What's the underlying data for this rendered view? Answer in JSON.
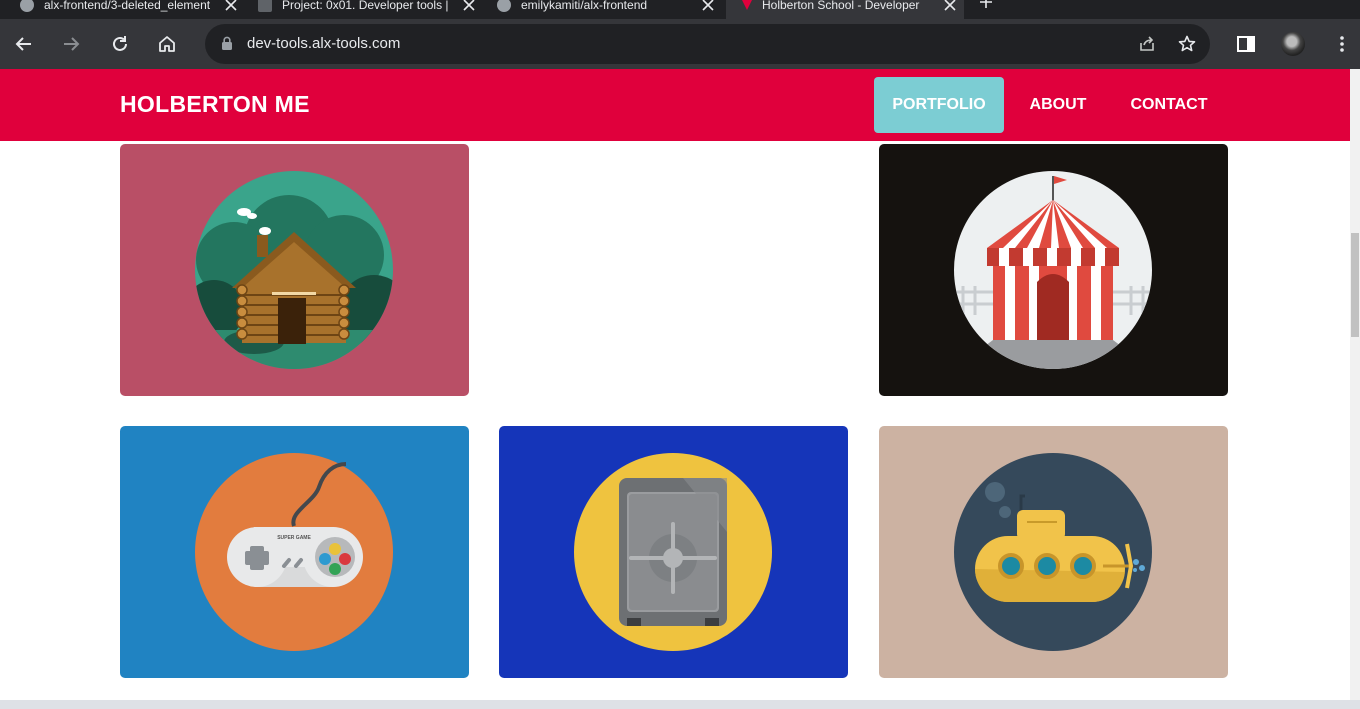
{
  "browser": {
    "tabs": [
      {
        "title": "alx-frontend/3-deleted_element"
      },
      {
        "title": "Project: 0x01. Developer tools |"
      },
      {
        "title": "emilykamiti/alx-frontend"
      },
      {
        "title": "Holberton School - Developer"
      }
    ],
    "url": "dev-tools.alx-tools.com",
    "icons": {
      "back": "back-arrow-icon",
      "forward": "forward-arrow-icon",
      "reload": "reload-icon",
      "home": "home-icon",
      "lock": "lock-icon",
      "share": "share-icon",
      "bookmark": "star-icon",
      "sidepanel": "side-panel-icon",
      "menu": "kebab-menu-icon"
    }
  },
  "site": {
    "brand": "HOLBERTON ME",
    "nav": [
      {
        "label": "PORTFOLIO",
        "active": true
      },
      {
        "label": "ABOUT",
        "active": false
      },
      {
        "label": "CONTACT",
        "active": false
      }
    ],
    "colors": {
      "nav_bg": "#e0003c",
      "nav_active": "#7ccdd3"
    }
  },
  "portfolio": [
    {
      "name": "log-cabin",
      "bg": "#b94f66"
    },
    {
      "name": "empty-slot",
      "bg": "#ffffff"
    },
    {
      "name": "circus-tent",
      "bg": "#15120f"
    },
    {
      "name": "game-controller",
      "bg": "#2083c2",
      "caption": "SUPER GAME"
    },
    {
      "name": "safe",
      "bg": "#1535b9"
    },
    {
      "name": "submarine",
      "bg": "#ccb2a2"
    }
  ]
}
